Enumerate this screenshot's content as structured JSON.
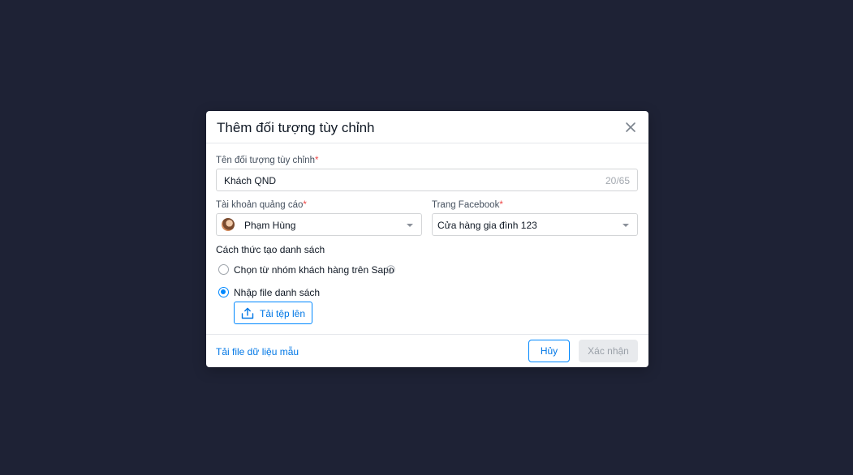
{
  "modal": {
    "title": "Thêm đối tượng tùy chỉnh"
  },
  "name_field": {
    "label": "Tên đối tượng tùy chỉnh",
    "required_mark": "*",
    "value": "Khách QND",
    "counter": "20/65"
  },
  "ad_account": {
    "label": "Tài khoản quảng cáo",
    "required_mark": "*",
    "selected": "Phạm Hùng"
  },
  "facebook_page": {
    "label": "Trang Facebook",
    "required_mark": "*",
    "selected": "Cửa hàng gia đình 123"
  },
  "creation_method": {
    "label": "Cách thức tạo danh sách",
    "options": [
      {
        "label": "Chọn từ nhóm khách hàng trên Sapo",
        "checked": false
      },
      {
        "label": "Nhập file danh sách",
        "checked": true
      }
    ]
  },
  "upload": {
    "label": "Tải tệp lên"
  },
  "footer": {
    "template_link": "Tải file dữ liệu mẫu",
    "cancel_label": "Hủy",
    "confirm_label": "Xác nhận"
  },
  "colors": {
    "overlay": "#1e2235",
    "accent": "#0088ff",
    "required": "#ee4747",
    "disabled_bg": "#e8eaed"
  }
}
